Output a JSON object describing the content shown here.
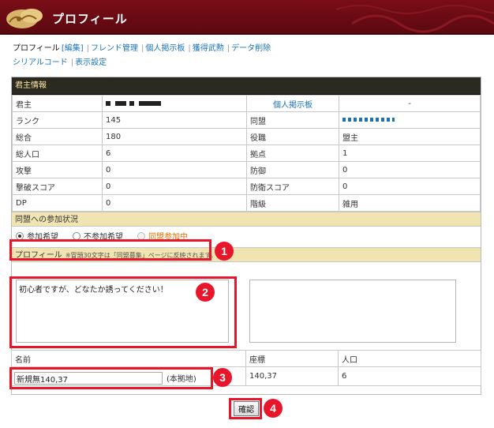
{
  "header": {
    "title": "プロフィール"
  },
  "tabs": {
    "profile": "プロフィール",
    "edit": "[編集]",
    "friend": "フレンド管理",
    "board": "個人掲示板",
    "medals": "獲得武勲",
    "delete": "データ削除",
    "serial": "シリアルコード",
    "display": "表示設定"
  },
  "lord_info": {
    "section_title": "君主情報",
    "lord_label": "君主",
    "lord_value": "",
    "board_link": "個人掲示板",
    "board_value": "-",
    "rows": [
      {
        "k1": "ランク",
        "v1": "145",
        "k2": "同盟",
        "v2": ""
      },
      {
        "k1": "総合",
        "v1": "180",
        "k2": "役職",
        "v2": "盟主"
      },
      {
        "k1": "総人口",
        "v1": "6",
        "k2": "拠点",
        "v2": "1"
      },
      {
        "k1": "攻撃",
        "v1": "0",
        "k2": "防御",
        "v2": "0"
      },
      {
        "k1": "撃破スコア",
        "v1": "0",
        "k2": "防衛スコア",
        "v2": "0"
      },
      {
        "k1": "DP",
        "v1": "0",
        "k2": "階級",
        "v2": "雑用"
      }
    ]
  },
  "alliance": {
    "section_title": "同盟への参加状況",
    "options": [
      "参加希望",
      "不参加希望",
      "同盟参加中"
    ],
    "selected": "参加希望"
  },
  "profile_section": {
    "title": "プロフィール",
    "note": "※冒頭30文字は「同盟募集」ページに反映されます。",
    "text_left": "初心者ですが、どなたか誘ってください！",
    "text_right": ""
  },
  "base": {
    "name_label": "名前",
    "coord_label": "座標",
    "pop_label": "人口",
    "name_value": "新規無140,37",
    "main_base": "(本拠地)",
    "coord_value": "140,37",
    "pop_value": "6"
  },
  "confirm_label": "確認",
  "badges": [
    "1",
    "2",
    "3",
    "4"
  ],
  "colors": {
    "header": "#6b0c14",
    "annot": "#e8162a",
    "sub_head": "#f0e5b0",
    "link": "#1a73b8"
  }
}
